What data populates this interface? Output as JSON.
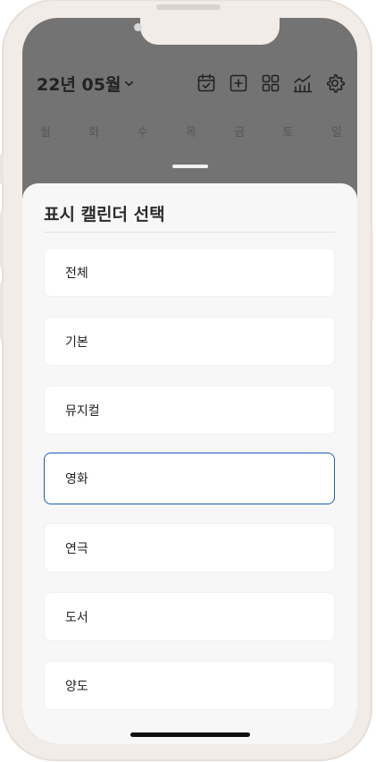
{
  "header": {
    "month_label": "22년 05월"
  },
  "header_icons": [
    "calendar-check-icon",
    "plus-square-icon",
    "grid-icon",
    "chart-icon",
    "gear-icon"
  ],
  "weekdays": [
    "월",
    "화",
    "수",
    "목",
    "금",
    "토",
    "일"
  ],
  "sheet": {
    "title": "표시 캘린더 선택",
    "options": [
      "전체",
      "기본",
      "뮤지컬",
      "영화",
      "연극",
      "도서",
      "양도"
    ],
    "selected_option": "영화"
  },
  "colors": {
    "dim_overlay": "#737373",
    "sheet_bg": "#f7f7f7",
    "selected_border": "#1c5bb8",
    "frame": "#f2ece8"
  }
}
